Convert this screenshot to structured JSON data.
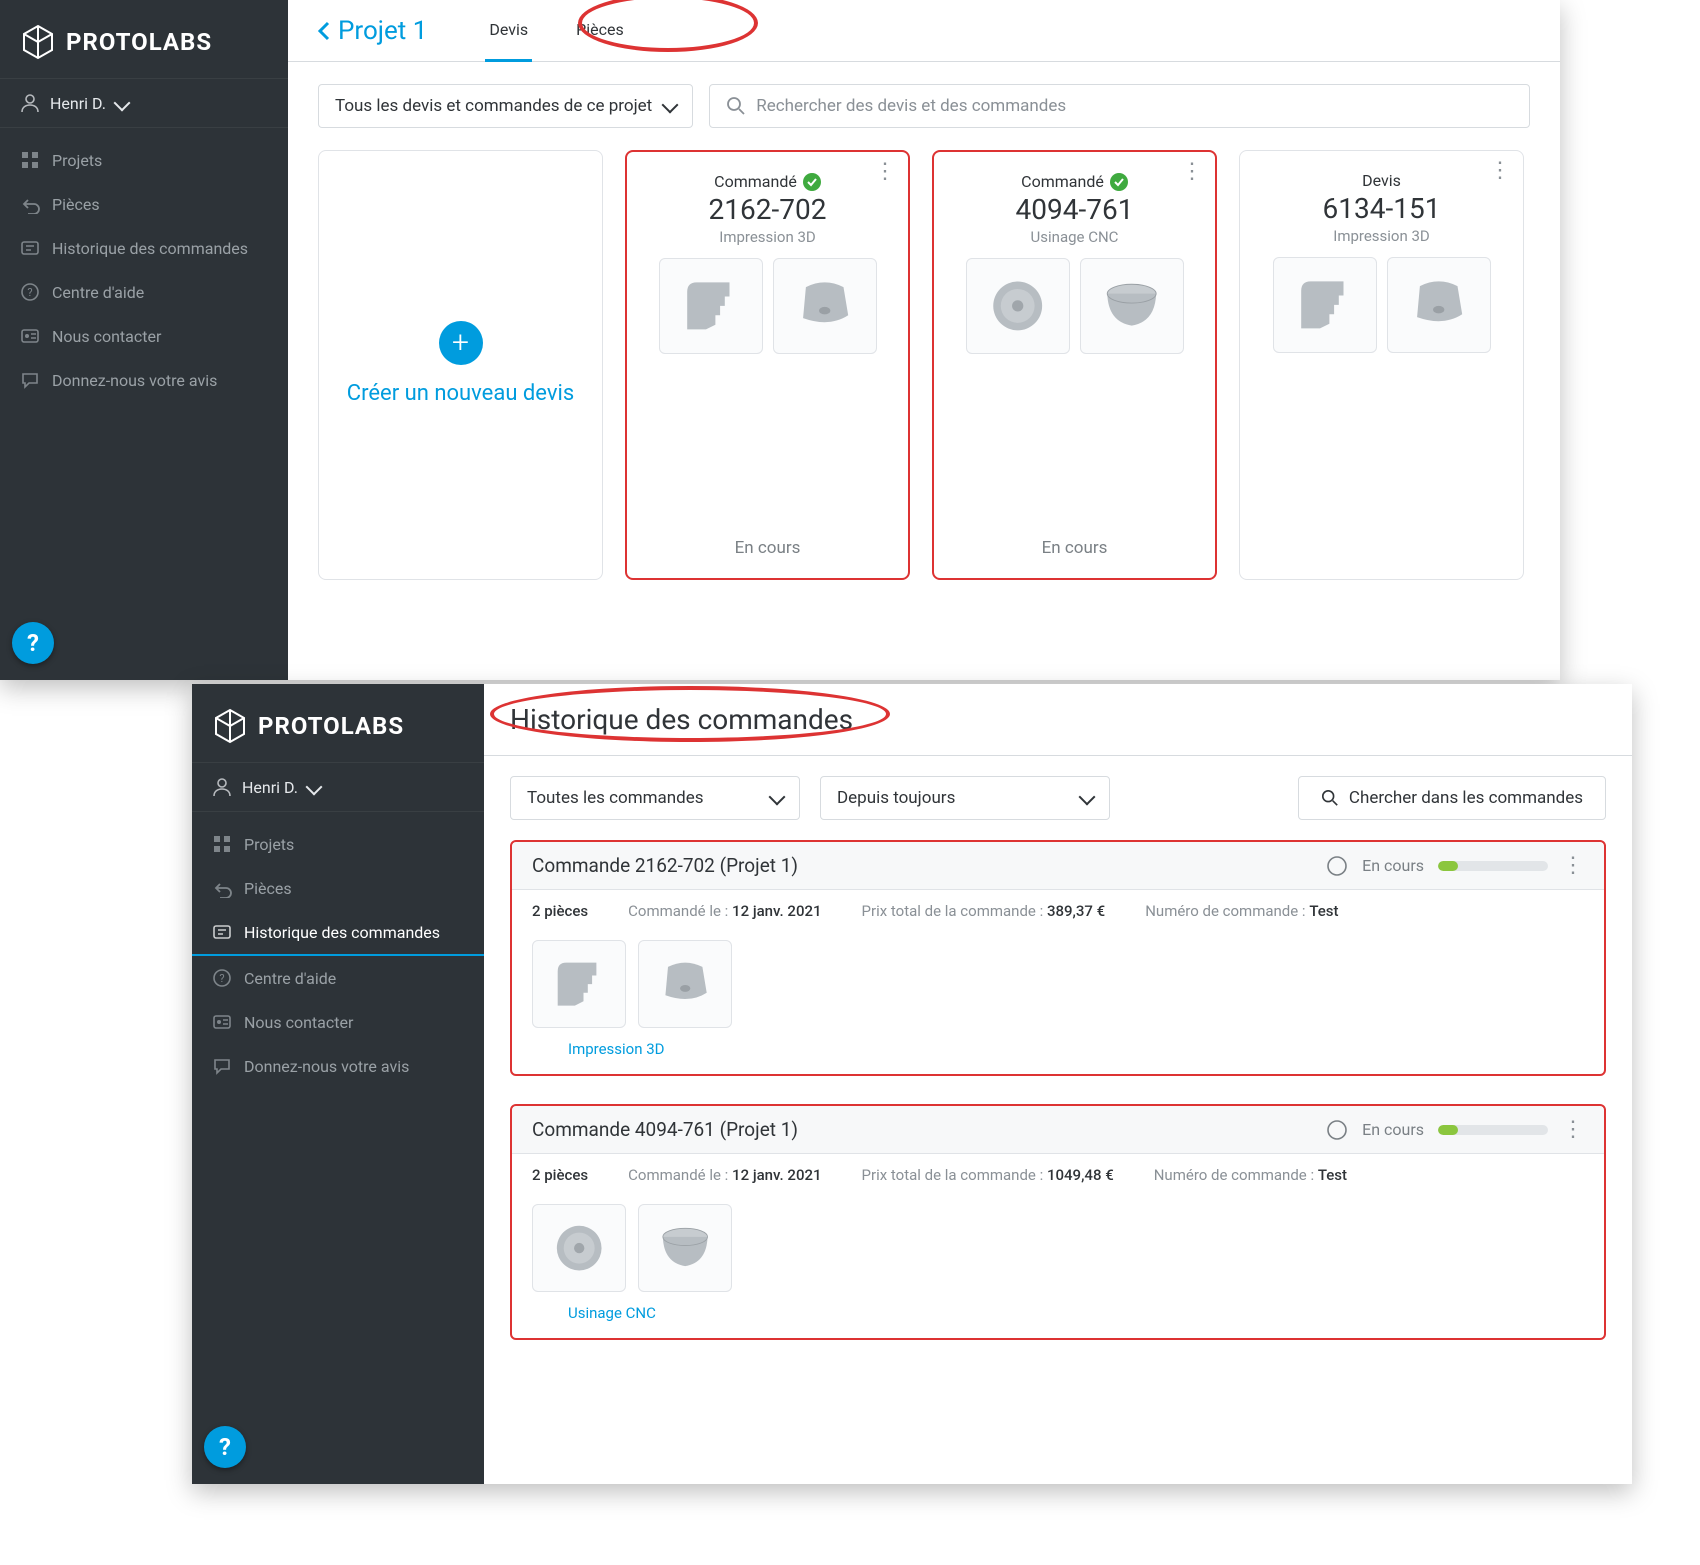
{
  "brand": "PROTOLABS",
  "user": "Henri D.",
  "sidebar_items": [
    {
      "icon": "grid",
      "label": "Projets"
    },
    {
      "icon": "undo",
      "label": "Pièces"
    },
    {
      "icon": "history",
      "label": "Historique des commandes"
    },
    {
      "icon": "help",
      "label": "Centre d'aide"
    },
    {
      "icon": "contact",
      "label": "Nous contacter"
    },
    {
      "icon": "feedback",
      "label": "Donnez-nous votre avis"
    }
  ],
  "panel1": {
    "breadcrumb": "Projet 1",
    "tabs": [
      {
        "label": "Devis",
        "active": true
      },
      {
        "label": "Pièces",
        "active": false
      }
    ],
    "filter_select": "Tous les devis et commandes de ce projet",
    "search_placeholder": "Rechercher des devis et des commandes",
    "new_quote_label": "Créer un nouveau devis",
    "cards": [
      {
        "status": "Commandé",
        "check": true,
        "quote": "2162-702",
        "tech": "Impression 3D",
        "thumbs": [
          "bracket",
          "shell"
        ],
        "footer": "En cours",
        "highlight": true
      },
      {
        "status": "Commandé",
        "check": true,
        "quote": "4094-761",
        "tech": "Usinage CNC",
        "thumbs": [
          "disc",
          "bowl"
        ],
        "footer": "En cours",
        "highlight": true
      },
      {
        "status": "Devis",
        "check": false,
        "quote": "6134-151",
        "tech": "Impression 3D",
        "thumbs": [
          "bracket",
          "shell"
        ],
        "footer": "",
        "highlight": false
      }
    ]
  },
  "panel2": {
    "title": "Historique des commandes",
    "filter1": "Toutes les commandes",
    "filter2": "Depuis toujours",
    "search_label": "Chercher dans les commandes",
    "orders": [
      {
        "title": "Commande 2162-702 (Projet 1)",
        "status": "En cours",
        "pieces": "2 pièces",
        "ordered_label": "Commandé le :",
        "ordered_value": "12 janv. 2021",
        "price_label": "Prix total de la commande :",
        "price_value": "389,37 €",
        "ordnum_label": "Numéro de commande :",
        "ordnum_value": "Test",
        "thumbs": [
          "bracket",
          "shell"
        ],
        "tech": "Impression 3D"
      },
      {
        "title": "Commande 4094-761 (Projet 1)",
        "status": "En cours",
        "pieces": "2 pièces",
        "ordered_label": "Commandé le :",
        "ordered_value": "12 janv. 2021",
        "price_label": "Prix total de la commande :",
        "price_value": "1049,48 €",
        "ordnum_label": "Numéro de commande :",
        "ordnum_value": "Test",
        "thumbs": [
          "disc",
          "bowl"
        ],
        "tech": "Usinage CNC"
      }
    ]
  }
}
